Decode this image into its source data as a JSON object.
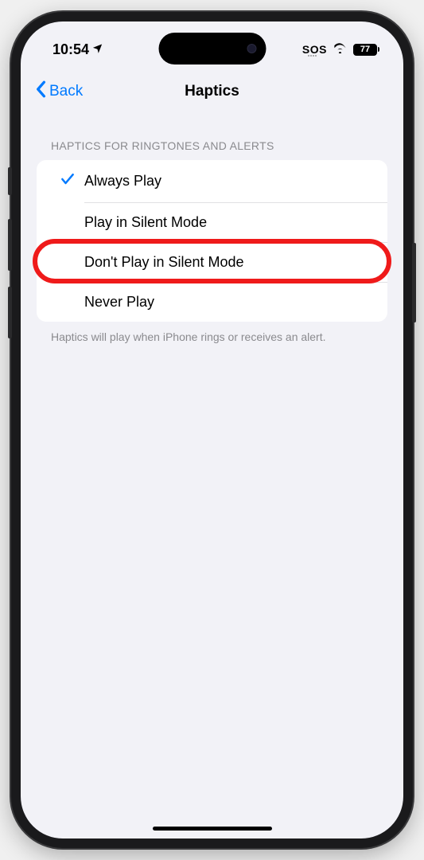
{
  "statusBar": {
    "time": "10:54",
    "sos": "SOS",
    "battery": "77"
  },
  "nav": {
    "back": "Back",
    "title": "Haptics"
  },
  "section": {
    "header": "HAPTICS FOR RINGTONES AND ALERTS",
    "footer": "Haptics will play when iPhone rings or receives an alert."
  },
  "options": [
    {
      "label": "Always Play",
      "selected": true
    },
    {
      "label": "Play in Silent Mode",
      "selected": false
    },
    {
      "label": "Don't Play in Silent Mode",
      "selected": false
    },
    {
      "label": "Never Play",
      "selected": false
    }
  ]
}
